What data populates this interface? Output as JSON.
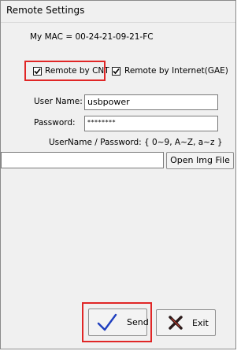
{
  "window": {
    "title": "Remote Settings"
  },
  "mac": {
    "label": "My MAC = 00-24-21-09-21-FC"
  },
  "options": [
    {
      "label": "Remote by CNT",
      "checked": true
    },
    {
      "label": "Remote by Internet(GAE)",
      "checked": true
    }
  ],
  "credentials": {
    "username_label": "User Name:",
    "username_value": "usbpower",
    "password_label": "Password:",
    "password_value": "********",
    "hint": "UserName / Password: { 0~9, A~Z, a~z }"
  },
  "image": {
    "path_value": "",
    "open_button": "Open Img File"
  },
  "actions": {
    "send_label": "Send",
    "exit_label": "Exit"
  },
  "colors": {
    "highlight": "#e02626",
    "send_check": "#1f3fbf",
    "exit_x": "#2a1a1a",
    "exit_x_accent": "#c0392b"
  }
}
